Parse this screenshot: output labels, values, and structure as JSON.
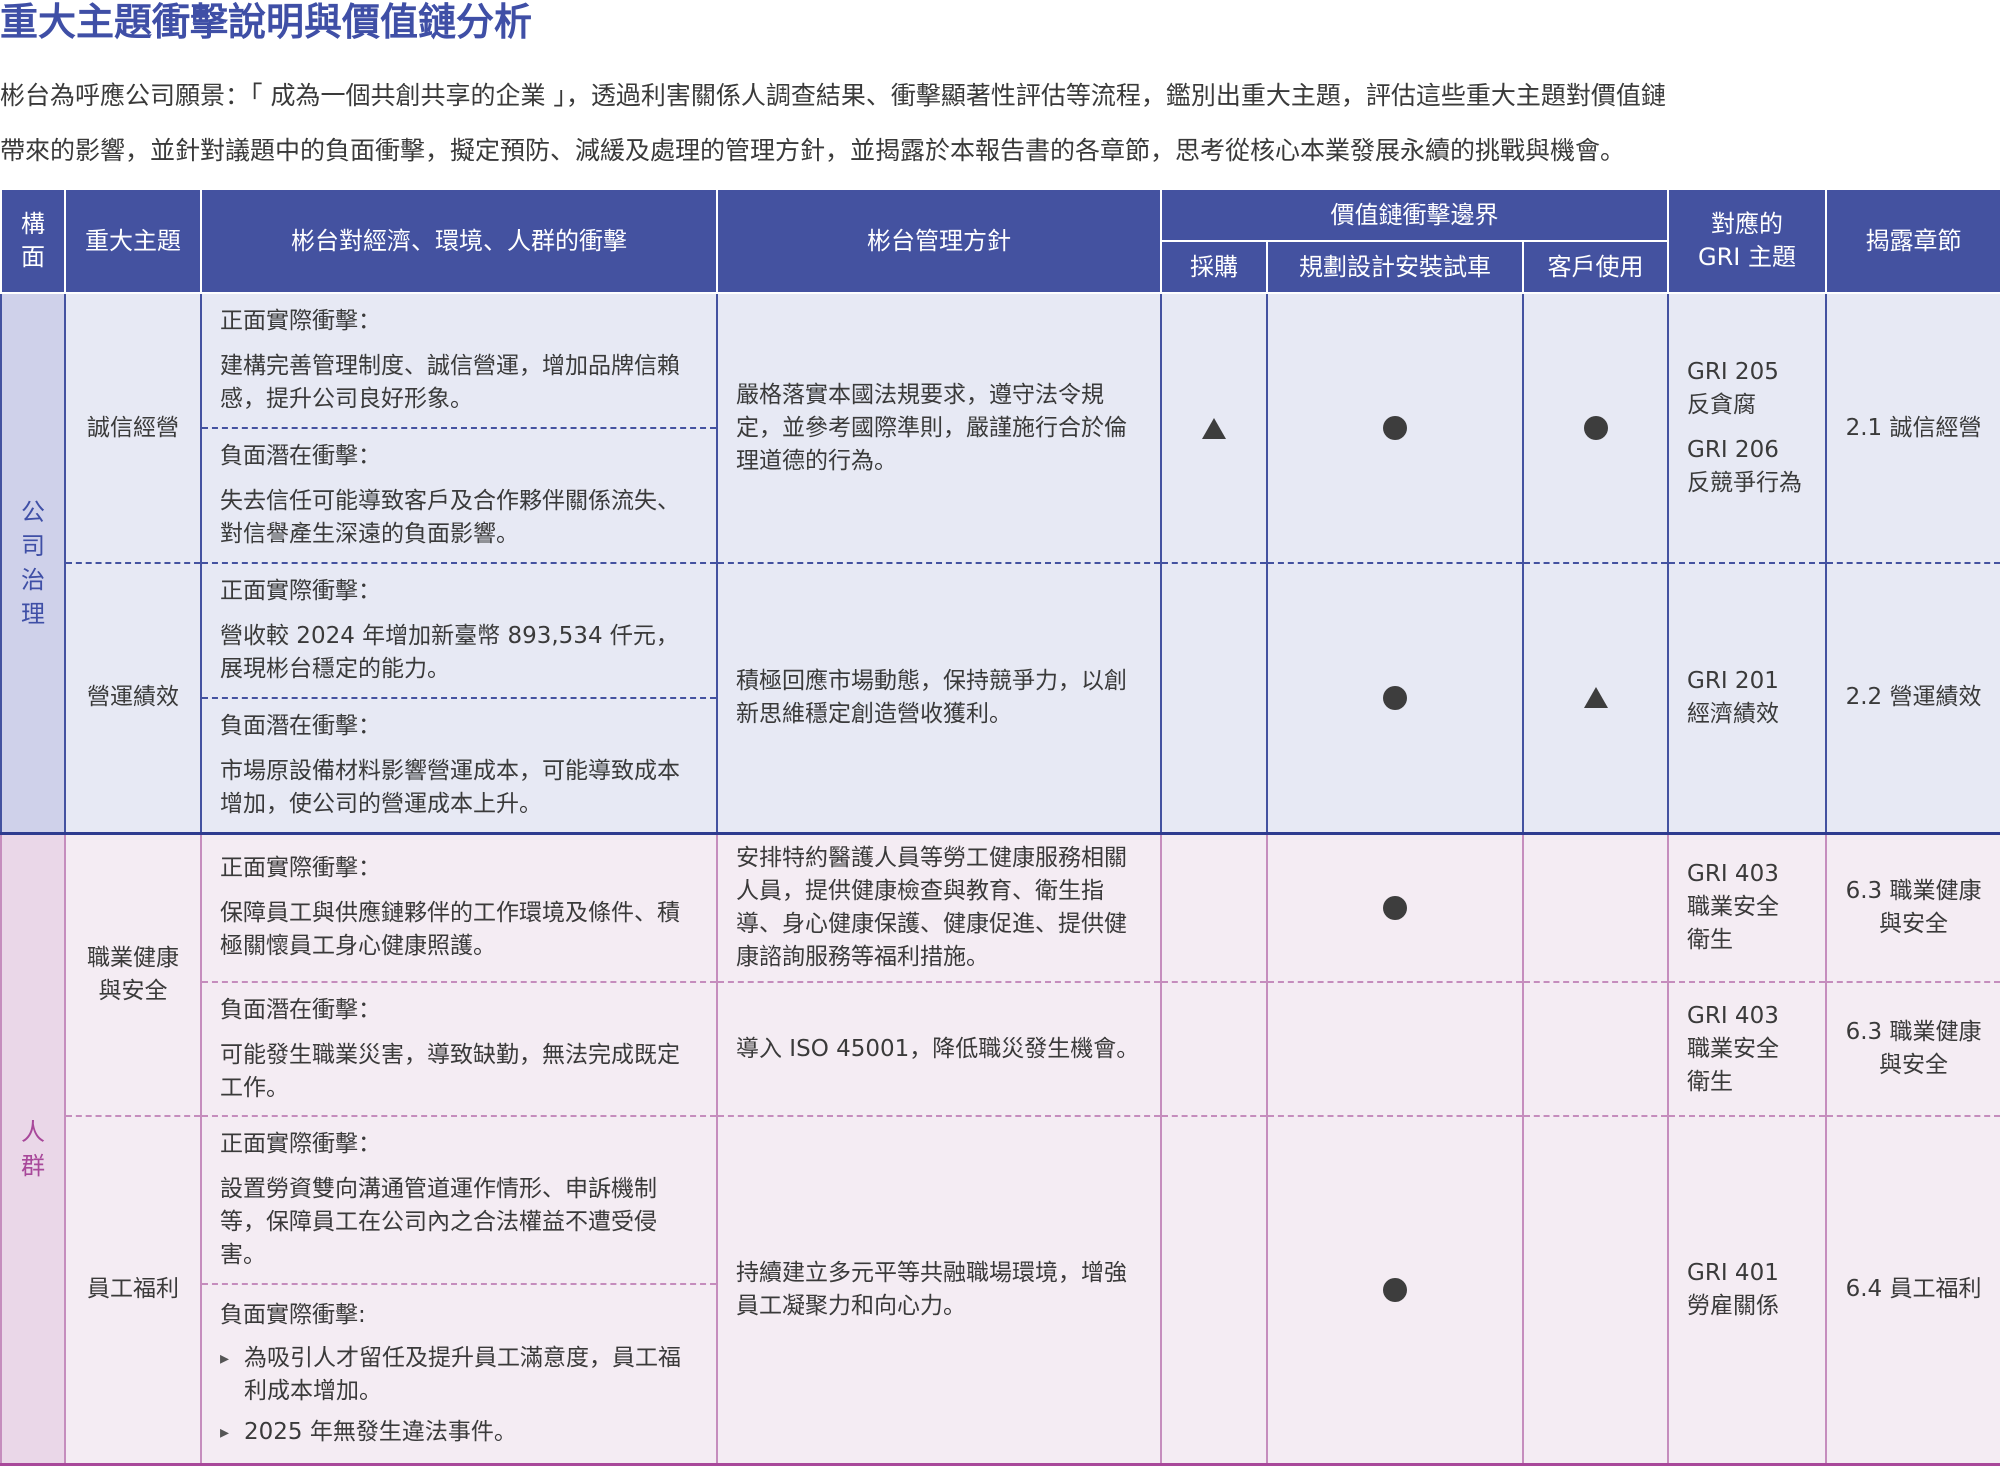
{
  "title": "重大主題衝擊說明與價值鏈分析",
  "intro": [
    "彬台為呼應公司願景：「 成為一個共創共享的企業 」，透過利害關係人調查結果、衝擊顯著性評估等流程，鑑別出重大主題，評估這些重大主題對價值鏈",
    "帶來的影響，並針對議題中的負面衝擊，擬定預防、減緩及處理的管理方針，並揭露於本報告書的各章節，思考從核心本業發展永續的挑戰與機會。"
  ],
  "headers": {
    "dimension": "構面",
    "topic": "重大主題",
    "impact": "彬台對經濟、環境、人群的衝擊",
    "policy": "彬台管理方針",
    "value_chain": "價值鏈衝擊邊界",
    "procurement": "採購",
    "design": "規劃設計安裝試車",
    "customer": "客戶使用",
    "gri_line1": "對應的",
    "gri_line2": "GRI 主題",
    "chapter": "揭露章節"
  },
  "symbols": {
    "triangle": "triangle",
    "circle": "circle"
  },
  "colors": {
    "header": "#4452a0",
    "governance_bg": "#e7e9f4",
    "governance_label": "#cfd1ea",
    "people_bg": "#f4ecf3",
    "people_label": "#ead7e8",
    "people_text": "#a8489a"
  },
  "rows": {
    "governance": {
      "dimension": "公司治理",
      "integrity": {
        "topic": "誠信經營",
        "pos_label": "正面實際衝擊：",
        "pos_text": "建構完善管理制度、誠信營運，增加品牌信賴感，提升公司良好形象。",
        "neg_label": "負面潛在衝擊：",
        "neg_text": "失去信任可能導致客戶及合作夥伴關係流失、對信譽產生深遠的負面影響。",
        "policy": "嚴格落實本國法規要求，遵守法令規定，並參考國際準則，嚴謹施行合於倫理道德的行為。",
        "procurement": "triangle",
        "design": "circle",
        "customer": "circle",
        "gri": [
          "GRI 205",
          "反貪腐",
          "GRI 206",
          "反競爭行為"
        ],
        "chapter": "2.1 誠信經營"
      },
      "operation": {
        "topic": "營運績效",
        "pos_label": "正面實際衝擊：",
        "pos_text": "營收較 2024 年增加新臺幣 893,534 仟元，展現彬台穩定的能力。",
        "neg_label": "負面潛在衝擊：",
        "neg_text": "市場原設備材料影響營運成本，可能導致成本增加，使公司的營運成本上升。",
        "policy": "積極回應市場動態，保持競爭力，以創新思維穩定創造營收獲利。",
        "design": "circle",
        "customer": "triangle",
        "gri": [
          "GRI 201",
          "經濟績效"
        ],
        "chapter": "2.2 營運績效"
      }
    },
    "people": {
      "dimension": "人群",
      "ohs": {
        "topic": "職業健康與安全",
        "pos_label": "正面實際衝擊：",
        "pos_text": "保障員工與供應鏈夥伴的工作環境及條件、積極關懷員工身心健康照護。",
        "pos_policy": "安排特約醫護人員等勞工健康服務相關人員，提供健康檢查與教育、衛生指導、身心健康保護、健康促進、提供健康諮詢服務等福利措施。",
        "pos_design": "circle",
        "pos_gri": [
          "GRI 403",
          "職業安全",
          "衛生"
        ],
        "pos_chapter": "6.3 職業健康與安全",
        "neg_label": "負面潛在衝擊：",
        "neg_text": "可能發生職業災害，導致缺勤，無法完成既定工作。",
        "neg_policy": "導入 ISO 45001，降低職災發生機會。",
        "neg_gri": [
          "GRI 403",
          "職業安全",
          "衛生"
        ],
        "neg_chapter": "6.3 職業健康與安全"
      },
      "welfare": {
        "topic": "員工福利",
        "pos_label": "正面實際衝擊：",
        "pos_text": "設置勞資雙向溝通管道運作情形、申訴機制等，保障員工在公司內之合法權益不遭受侵害。",
        "neg_label": "負面實際衝擊:",
        "neg_bullets": [
          "為吸引人才留任及提升員工滿意度，員工福利成本增加。",
          "2025 年無發生違法事件。"
        ],
        "policy": "持續建立多元平等共融職場環境，增強員工凝聚力和向心力。",
        "design": "circle",
        "gri": [
          "GRI 401",
          "勞雇關係"
        ],
        "chapter": "6.4 員工福利"
      }
    }
  }
}
